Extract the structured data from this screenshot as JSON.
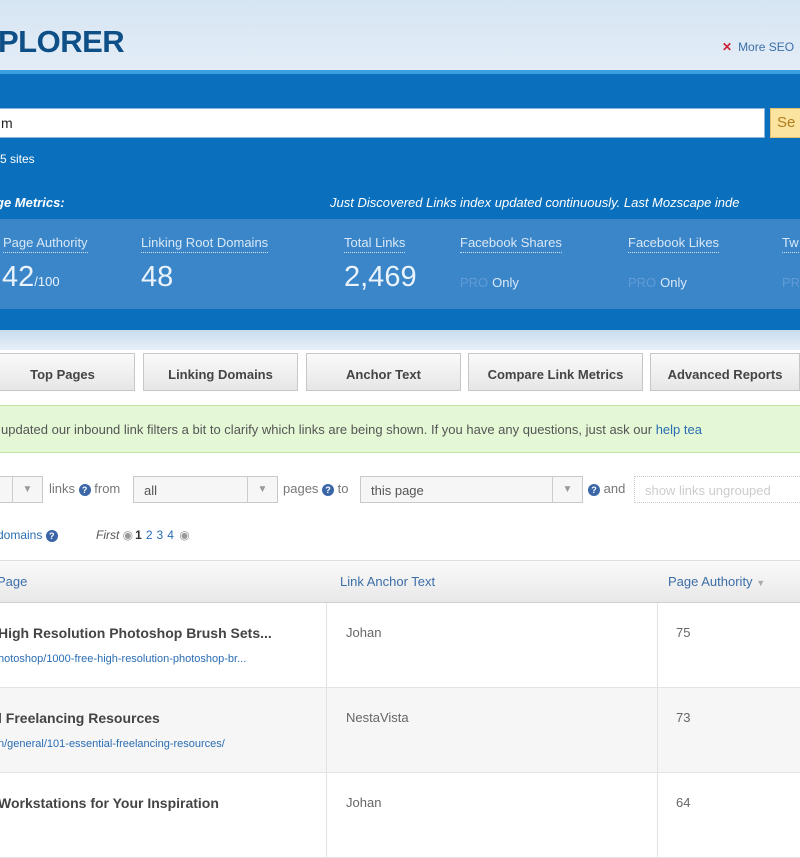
{
  "header": {
    "logo": "PLORER",
    "more_link": "More SEO",
    "more_icon": "x-icon"
  },
  "search": {
    "value": "m",
    "button": "Se",
    "sites_text": "5 sites"
  },
  "metrics": {
    "heading": "ge Metrics:",
    "index_note": "Just Discovered Links index updated continuously. Last Mozscape inde",
    "items": [
      {
        "label": "Page Authority",
        "value": "42",
        "suffix": "/100"
      },
      {
        "label": "Linking Root Domains",
        "value": "48"
      },
      {
        "label": "Total Links",
        "value": "2,469"
      },
      {
        "label": "Facebook Shares",
        "pro": "PRO",
        "only": "Only"
      },
      {
        "label": "Facebook Likes",
        "pro": "PRO",
        "only": "Only"
      },
      {
        "label": "Tw",
        "pro": "PRO"
      }
    ]
  },
  "tabs": [
    "Top Pages",
    "Linking Domains",
    "Anchor Text",
    "Compare Link Metrics",
    "Advanced Reports"
  ],
  "notice": {
    "text": "updated our inbound link filters a bit to clarify which links are being shown. If you have any questions, just ask our ",
    "link": "help tea"
  },
  "filters": {
    "links": "links",
    "from": "from",
    "from_value": "all",
    "pages": "pages",
    "to": "to",
    "to_value": "this page",
    "and": "and",
    "group_placeholder": "show links ungrouped"
  },
  "pagination": {
    "domains": "domains",
    "first": "First",
    "pages": [
      "1",
      "2",
      "3",
      "4"
    ]
  },
  "table": {
    "columns": [
      "Page",
      "Link Anchor Text",
      "Page Authority"
    ],
    "sort_icon": "▼",
    "rows": [
      {
        "title": "High Resolution Photoshop Brush Sets...",
        "url": "hotoshop/1000-free-high-resolution-photoshop-br...",
        "anchor": "Johan",
        "pa": "75"
      },
      {
        "title": "l Freelancing Resources",
        "url": "n/general/101-essential-freelancing-resources/",
        "anchor": "NestaVista",
        "pa": "73"
      },
      {
        "title": "Workstations for Your Inspiration",
        "url": "",
        "anchor": "Johan",
        "pa": "64"
      }
    ]
  }
}
